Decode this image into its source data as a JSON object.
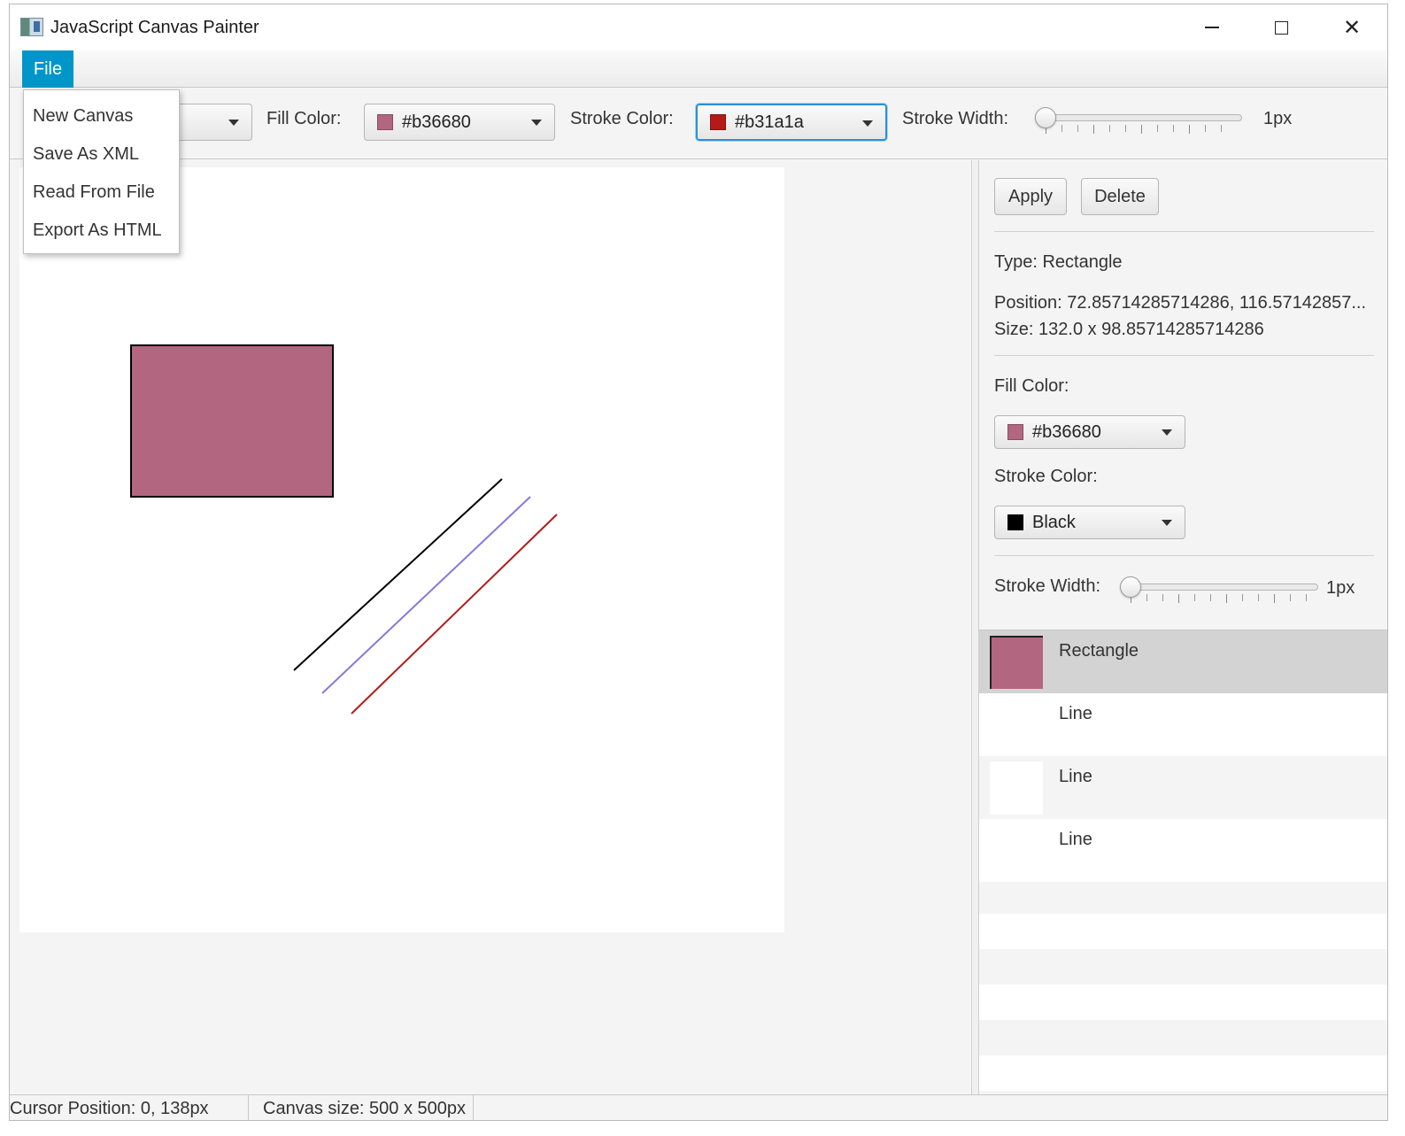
{
  "window": {
    "title": "JavaScript Canvas Painter"
  },
  "menu": {
    "file_label": "File",
    "file_items": [
      "New Canvas",
      "Save As XML",
      "Read From File",
      "Export As HTML"
    ]
  },
  "toolbar": {
    "fill_label": "Fill Color:",
    "fill_value": "#b36680",
    "fill_color": "#b36680",
    "stroke_label": "Stroke Color:",
    "stroke_value": "#b31a1a",
    "stroke_color": "#b31a1a",
    "width_label": "Stroke Width:",
    "width_value": "1px",
    "width_level": 0
  },
  "canvas": {
    "shapes": [
      {
        "type": "rectangle",
        "fill": "#b36680",
        "stroke": "#000000"
      },
      {
        "type": "line",
        "stroke": "#000000"
      },
      {
        "type": "line",
        "stroke": "#8878d8"
      },
      {
        "type": "line",
        "stroke": "#b31a1a"
      }
    ]
  },
  "panel": {
    "apply_label": "Apply",
    "delete_label": "Delete",
    "type_text": "Type: Rectangle",
    "position_text": "Position: 72.85714285714286, 116.57142857...",
    "size_text": "Size: 132.0 x 98.85714285714286",
    "fill_label": "Fill Color:",
    "fill_value": "#b36680",
    "fill_color": "#b36680",
    "stroke_label": "Stroke Color:",
    "stroke_value": "Black",
    "stroke_color": "#000000",
    "width_label": "Stroke Width:",
    "width_value": "1px",
    "width_level": 0
  },
  "shape_list": [
    {
      "label": "Rectangle",
      "thumb_color": "#b36680",
      "selected": true
    },
    {
      "label": "Line",
      "selected": false
    },
    {
      "label": "Line",
      "selected": false
    },
    {
      "label": "Line",
      "selected": false
    }
  ],
  "status": {
    "cursor": "Cursor Position: 0, 138px",
    "canvas_size": "Canvas size: 500 x 500px"
  }
}
